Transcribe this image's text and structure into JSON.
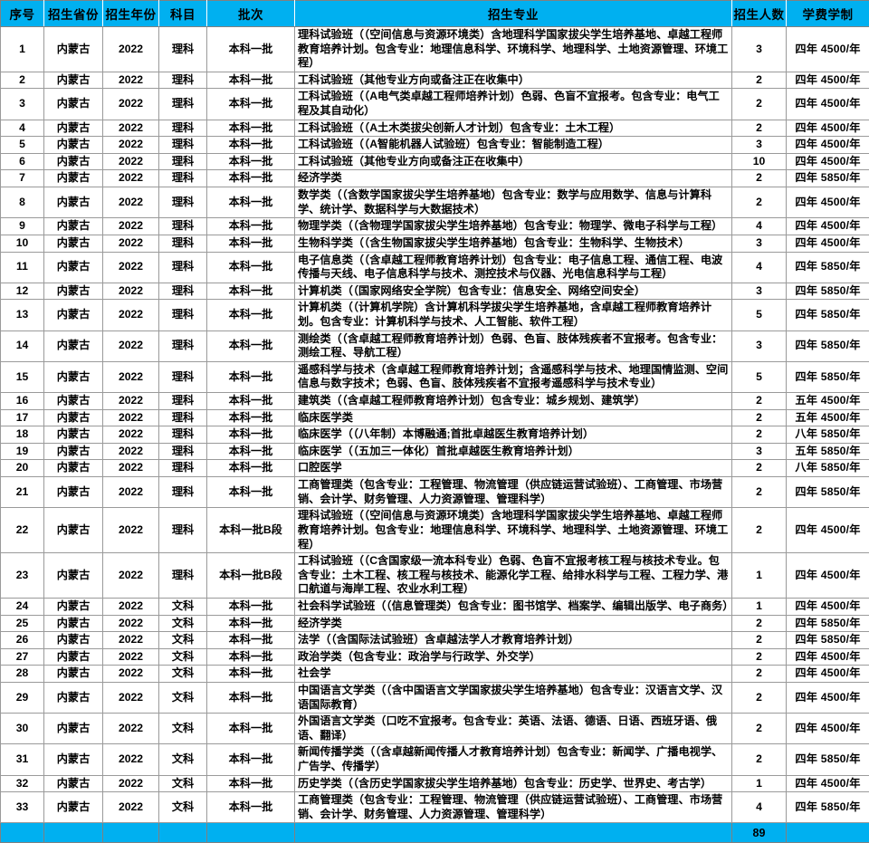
{
  "table": {
    "headers": [
      "序号",
      "招生省份",
      "招生年份",
      "科目",
      "批次",
      "招生专业",
      "招生人数",
      "学费学制"
    ],
    "rows": [
      {
        "seq": "1",
        "province": "内蒙古",
        "year": "2022",
        "subject": "理科",
        "batch": "本科一批",
        "major": "理科试验班（（空间信息与资源环境类）含地理科学国家拔尖学生培养基地、卓越工程师教育培养计划。包含专业：地理信息科学、环境科学、地理科学、土地资源管理、环境工程）",
        "count": "3",
        "fee": "四年 4500/年"
      },
      {
        "seq": "2",
        "province": "内蒙古",
        "year": "2022",
        "subject": "理科",
        "batch": "本科一批",
        "major": "工科试验班（其他专业方向或备注正在收集中）",
        "count": "2",
        "fee": "四年 4500/年"
      },
      {
        "seq": "3",
        "province": "内蒙古",
        "year": "2022",
        "subject": "理科",
        "batch": "本科一批",
        "major": "工科试验班（（A电气类卓越工程师培养计划）色弱、色盲不宜报考。包含专业：电气工程及其自动化）",
        "count": "2",
        "fee": "四年 4500/年"
      },
      {
        "seq": "4",
        "province": "内蒙古",
        "year": "2022",
        "subject": "理科",
        "batch": "本科一批",
        "major": "工科试验班（（A土木类拔尖创新人才计划）包含专业：土木工程）",
        "count": "2",
        "fee": "四年 4500/年"
      },
      {
        "seq": "5",
        "province": "内蒙古",
        "year": "2022",
        "subject": "理科",
        "batch": "本科一批",
        "major": "工科试验班（（A智能机器人试验班）包含专业：智能制造工程）",
        "count": "3",
        "fee": "四年 4500/年"
      },
      {
        "seq": "6",
        "province": "内蒙古",
        "year": "2022",
        "subject": "理科",
        "batch": "本科一批",
        "major": "工科试验班（其他专业方向或备注正在收集中）",
        "count": "10",
        "fee": "四年 4500/年"
      },
      {
        "seq": "7",
        "province": "内蒙古",
        "year": "2022",
        "subject": "理科",
        "batch": "本科一批",
        "major": "经济学类",
        "count": "2",
        "fee": "四年 5850/年"
      },
      {
        "seq": "8",
        "province": "内蒙古",
        "year": "2022",
        "subject": "理科",
        "batch": "本科一批",
        "major": "数学类（（含数学国家拔尖学生培养基地）包含专业：数学与应用数学、信息与计算科学、统计学、数据科学与大数据技术）",
        "count": "2",
        "fee": "四年 4500/年"
      },
      {
        "seq": "9",
        "province": "内蒙古",
        "year": "2022",
        "subject": "理科",
        "batch": "本科一批",
        "major": "物理学类（（含物理学国家拔尖学生培养基地）包含专业：物理学、微电子科学与工程）",
        "count": "4",
        "fee": "四年 4500/年"
      },
      {
        "seq": "10",
        "province": "内蒙古",
        "year": "2022",
        "subject": "理科",
        "batch": "本科一批",
        "major": "生物科学类（（含生物国家拔尖学生培养基地）包含专业：生物科学、生物技术）",
        "count": "3",
        "fee": "四年 4500/年"
      },
      {
        "seq": "11",
        "province": "内蒙古",
        "year": "2022",
        "subject": "理科",
        "batch": "本科一批",
        "major": "电子信息类（（含卓越工程师教育培养计划）包含专业：电子信息工程、通信工程、电波传播与天线、电子信息科学与技术、测控技术与仪器、光电信息科学与工程）",
        "count": "4",
        "fee": "四年 5850/年"
      },
      {
        "seq": "12",
        "province": "内蒙古",
        "year": "2022",
        "subject": "理科",
        "batch": "本科一批",
        "major": "计算机类（（国家网络安全学院）包含专业：信息安全、网络空间安全）",
        "count": "3",
        "fee": "四年 5850/年"
      },
      {
        "seq": "13",
        "province": "内蒙古",
        "year": "2022",
        "subject": "理科",
        "batch": "本科一批",
        "major": "计算机类（（计算机学院）含计算机科学拔尖学生培养基地，含卓越工程师教育培养计划。包含专业：计算机科学与技术、人工智能、软件工程）",
        "count": "5",
        "fee": "四年 5850/年"
      },
      {
        "seq": "14",
        "province": "内蒙古",
        "year": "2022",
        "subject": "理科",
        "batch": "本科一批",
        "major": "测绘类（（含卓越工程师教育培养计划）色弱、色盲、肢体残疾者不宜报考。包含专业：测绘工程、导航工程）",
        "count": "3",
        "fee": "四年 5850/年"
      },
      {
        "seq": "15",
        "province": "内蒙古",
        "year": "2022",
        "subject": "理科",
        "batch": "本科一批",
        "major": "遥感科学与技术（含卓越工程师教育培养计划；含遥感科学与技术、地理国情监测、空间信息与数字技术；色弱、色盲、肢体残疾者不宜报考遥感科学与技术专业）",
        "count": "5",
        "fee": "四年 5850/年"
      },
      {
        "seq": "16",
        "province": "内蒙古",
        "year": "2022",
        "subject": "理科",
        "batch": "本科一批",
        "major": "建筑类（（含卓越工程师教育培养计划）包含专业：城乡规划、建筑学）",
        "count": "2",
        "fee": "五年 4500/年"
      },
      {
        "seq": "17",
        "province": "内蒙古",
        "year": "2022",
        "subject": "理科",
        "batch": "本科一批",
        "major": "临床医学类",
        "count": "2",
        "fee": "五年 4500/年"
      },
      {
        "seq": "18",
        "province": "内蒙古",
        "year": "2022",
        "subject": "理科",
        "batch": "本科一批",
        "major": "临床医学（（八年制）本博融通;首批卓越医生教育培养计划）",
        "count": "2",
        "fee": "八年 5850/年"
      },
      {
        "seq": "19",
        "province": "内蒙古",
        "year": "2022",
        "subject": "理科",
        "batch": "本科一批",
        "major": "临床医学（（五加三一体化）首批卓越医生教育培养计划）",
        "count": "3",
        "fee": "五年 5850/年"
      },
      {
        "seq": "20",
        "province": "内蒙古",
        "year": "2022",
        "subject": "理科",
        "batch": "本科一批",
        "major": "口腔医学",
        "count": "2",
        "fee": "八年 5850/年"
      },
      {
        "seq": "21",
        "province": "内蒙古",
        "year": "2022",
        "subject": "理科",
        "batch": "本科一批",
        "major": "工商管理类（包含专业：工程管理、物流管理（供应链运营试验班）、工商管理、市场营销、会计学、财务管理、人力资源管理、管理科学）",
        "count": "2",
        "fee": "四年 5850/年"
      },
      {
        "seq": "22",
        "province": "内蒙古",
        "year": "2022",
        "subject": "理科",
        "batch": "本科一批B段",
        "major": "理科试验班（（空间信息与资源环境类）含地理科学国家拔尖学生培养基地、卓越工程师教育培养计划。包含专业：地理信息科学、环境科学、地理科学、土地资源管理、环境工程）",
        "count": "2",
        "fee": "四年 4500/年"
      },
      {
        "seq": "23",
        "province": "内蒙古",
        "year": "2022",
        "subject": "理科",
        "batch": "本科一批B段",
        "major": "工科试验班（（C含国家级一流本科专业）色弱、色盲不宜报考核工程与核技术专业。包含专业：土木工程、核工程与核技术、能源化学工程、给排水科学与工程、工程力学、港口航道与海岸工程、农业水利工程）",
        "count": "1",
        "fee": "四年 4500/年"
      },
      {
        "seq": "24",
        "province": "内蒙古",
        "year": "2022",
        "subject": "文科",
        "batch": "本科一批",
        "major": "社会科学试验班（（信息管理类）包含专业：图书馆学、档案学、编辑出版学、电子商务）",
        "count": "1",
        "fee": "四年 4500/年"
      },
      {
        "seq": "25",
        "province": "内蒙古",
        "year": "2022",
        "subject": "文科",
        "batch": "本科一批",
        "major": "经济学类",
        "count": "2",
        "fee": "四年 5850/年"
      },
      {
        "seq": "26",
        "province": "内蒙古",
        "year": "2022",
        "subject": "文科",
        "batch": "本科一批",
        "major": "法学（（含国际法试验班）含卓越法学人才教育培养计划）",
        "count": "2",
        "fee": "四年 5850/年"
      },
      {
        "seq": "27",
        "province": "内蒙古",
        "year": "2022",
        "subject": "文科",
        "batch": "本科一批",
        "major": "政治学类（包含专业：政治学与行政学、外交学）",
        "count": "2",
        "fee": "四年 4500/年"
      },
      {
        "seq": "28",
        "province": "内蒙古",
        "year": "2022",
        "subject": "文科",
        "batch": "本科一批",
        "major": "社会学",
        "count": "2",
        "fee": "四年 4500/年"
      },
      {
        "seq": "29",
        "province": "内蒙古",
        "year": "2022",
        "subject": "文科",
        "batch": "本科一批",
        "major": "中国语言文学类（（含中国语言文学国家拔尖学生培养基地）包含专业：汉语言文学、汉语国际教育）",
        "count": "2",
        "fee": "四年 4500/年"
      },
      {
        "seq": "30",
        "province": "内蒙古",
        "year": "2022",
        "subject": "文科",
        "batch": "本科一批",
        "major": "外国语言文学类（口吃不宜报考。包含专业：英语、法语、德语、日语、西班牙语、俄语、翻译）",
        "count": "2",
        "fee": "四年 4500/年"
      },
      {
        "seq": "31",
        "province": "内蒙古",
        "year": "2022",
        "subject": "文科",
        "batch": "本科一批",
        "major": "新闻传播学类（（含卓越新闻传播人才教育培养计划）包含专业：新闻学、广播电视学、广告学、传播学）",
        "count": "2",
        "fee": "四年 5850/年"
      },
      {
        "seq": "32",
        "province": "内蒙古",
        "year": "2022",
        "subject": "文科",
        "batch": "本科一批",
        "major": "历史学类（（含历史学国家拔尖学生培养基地）包含专业：历史学、世界史、考古学）",
        "count": "1",
        "fee": "四年 4500/年"
      },
      {
        "seq": "33",
        "province": "内蒙古",
        "year": "2022",
        "subject": "文科",
        "batch": "本科一批",
        "major": "工商管理类（包含专业：工程管理、物流管理（供应链运营试验班）、工商管理、市场营销、会计学、财务管理、人力资源管理、管理科学）",
        "count": "4",
        "fee": "四年 5850/年"
      }
    ],
    "total_row": {
      "seq": "",
      "province": "",
      "year": "",
      "subject": "",
      "batch": "",
      "major": "",
      "count": "89",
      "fee": ""
    }
  },
  "colors": {
    "header_background": "#00B0F0",
    "border": "#9a9a9a",
    "text": "#000000"
  }
}
